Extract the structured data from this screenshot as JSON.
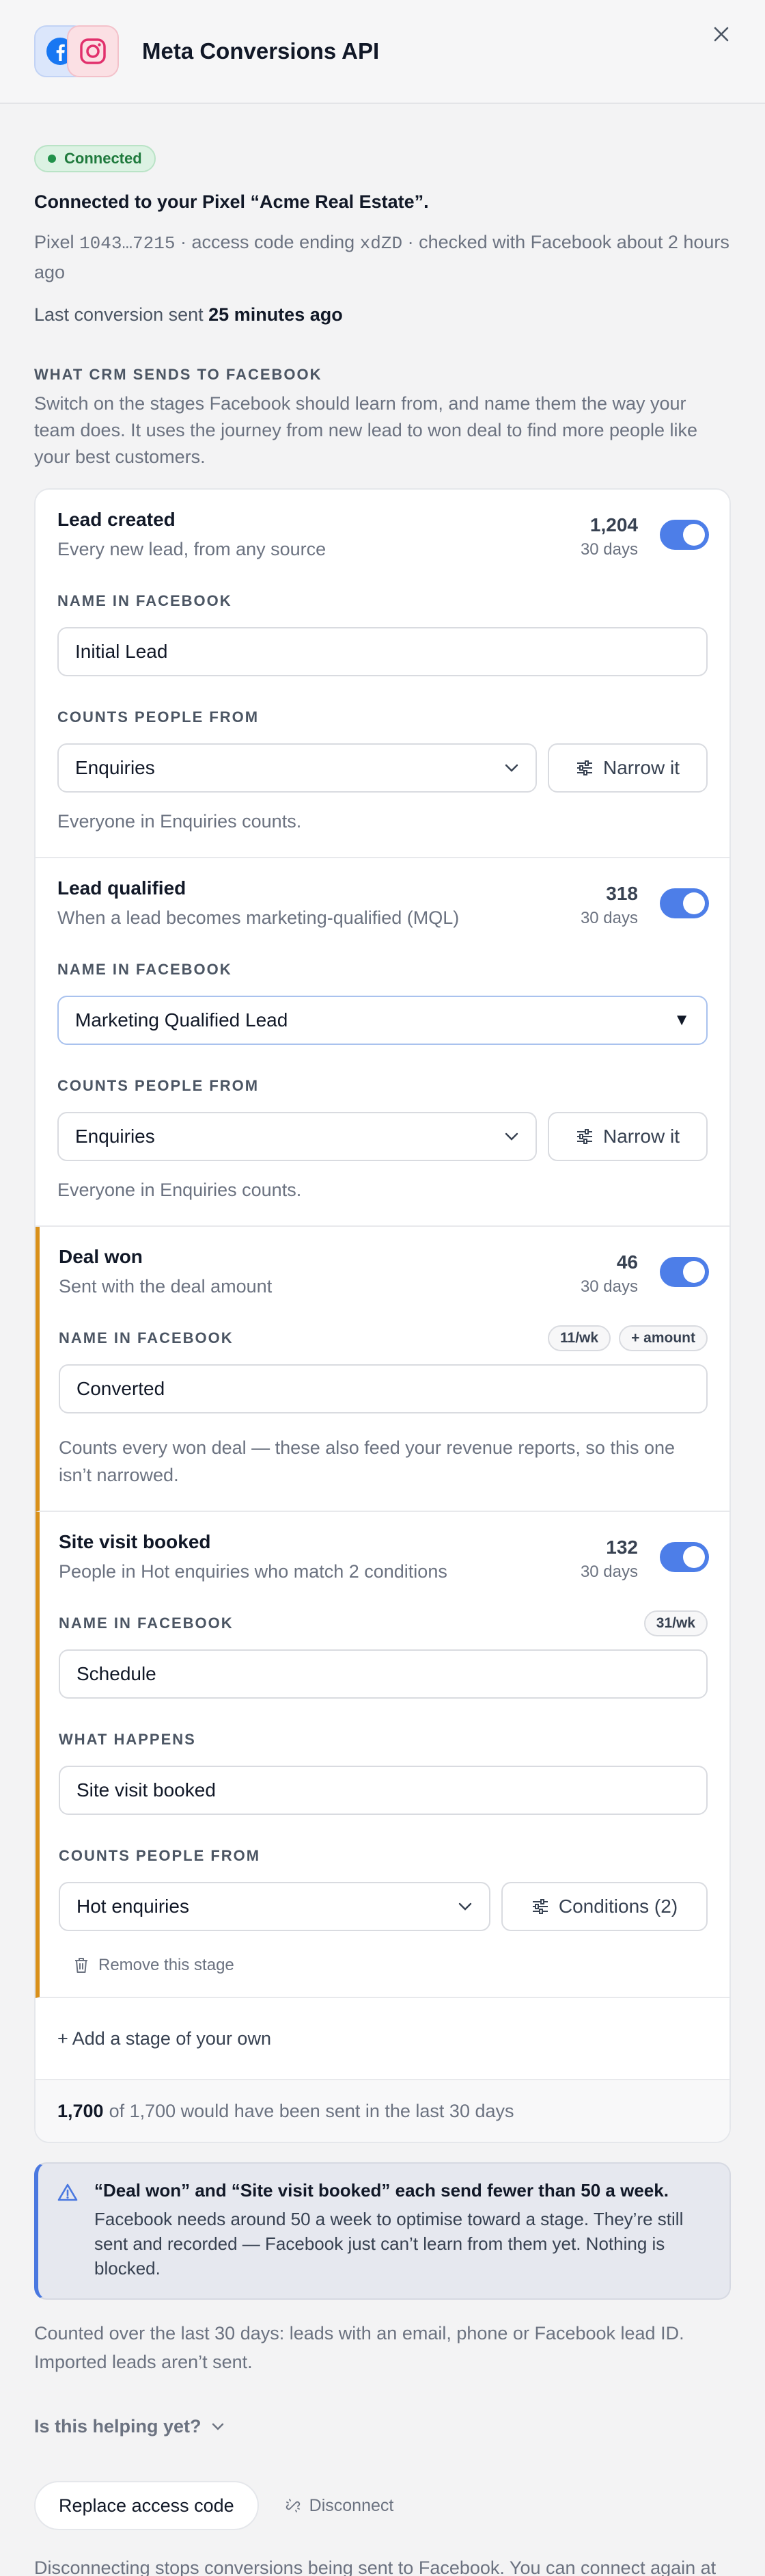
{
  "header": {
    "title": "Meta Conversions API",
    "close_icon": "close-icon"
  },
  "status": {
    "badge": "Connected",
    "connected_title": "Connected to your Pixel “Acme Real Estate”.",
    "pixel_prefix": "Pixel",
    "pixel_id": "1043…7215",
    "access_mid": "· access code ending",
    "access_code": "xdZD",
    "checked_text": "· checked with Facebook about 2 hours ago",
    "last_sent_label": "Last conversion sent",
    "last_sent_value": "25 minutes ago"
  },
  "section": {
    "label": "WHAT CRM SENDS TO FACEBOOK",
    "description": "Switch on the stages Facebook should learn from, and name them the way your team does. It uses the journey from new lead to won deal to find more people like your best customers."
  },
  "labels": {
    "name_in_facebook": "NAME IN FACEBOOK",
    "counts_people_from": "COUNTS PEOPLE FROM",
    "what_happens": "WHAT HAPPENS",
    "narrow_it": "Narrow it",
    "conditions": "Conditions (2)",
    "remove_stage": "Remove this stage",
    "add_stage": "+ Add a stage of your own"
  },
  "stages": [
    {
      "title": "Lead created",
      "description": "Every new lead, from any source",
      "count": "1,204",
      "period": "30 days",
      "enabled": true,
      "fb_name": "Initial Lead",
      "source": "Enquiries",
      "note": "Everyone in Enquiries counts."
    },
    {
      "title": "Lead qualified",
      "description": "When a lead becomes marketing-qualified (MQL)",
      "count": "318",
      "period": "30 days",
      "enabled": true,
      "fb_name": "Marketing Qualified Lead",
      "source": "Enquiries",
      "note": "Everyone in Enquiries counts."
    },
    {
      "title": "Deal won",
      "description": "Sent with the deal amount",
      "count": "46",
      "period": "30 days",
      "enabled": true,
      "chips": [
        "11/wk",
        "+ amount"
      ],
      "fb_name": "Converted",
      "note": "Counts every won deal — these also feed your revenue reports, so this one isn’t narrowed."
    },
    {
      "title": "Site visit booked",
      "description": "People in Hot enquiries who match 2 conditions",
      "count": "132",
      "period": "30 days",
      "enabled": true,
      "chips": [
        "31/wk"
      ],
      "fb_name": "Schedule",
      "what_happens": "Site visit booked",
      "source": "Hot enquiries"
    }
  ],
  "summary": {
    "sent": "1,700",
    "rest": "of 1,700 would have been sent in the last 30 days"
  },
  "warning": {
    "icon": "warning-triangle-icon",
    "title": "“Deal won” and “Site visit booked” each send fewer than 50 a week.",
    "body": "Facebook needs around 50 a week to optimise toward a stage. They’re still sent and recorded — Facebook just can’t learn from them yet. Nothing is blocked."
  },
  "footnote": "Counted over the last 30 days: leads with an email, phone or Facebook lead ID. Imported leads aren’t sent.",
  "helping": "Is this helping yet?",
  "actions": {
    "replace": "Replace access code",
    "disconnect": "Disconnect",
    "disconnect_note": "Disconnecting stops conversions being sent to Facebook. You can connect again at any time."
  },
  "colors": {
    "toggle_on": "#4d7ee8",
    "flag_border": "#d9901a",
    "connected_green": "#1f7a3d",
    "warning_accent": "#4a78e0"
  }
}
